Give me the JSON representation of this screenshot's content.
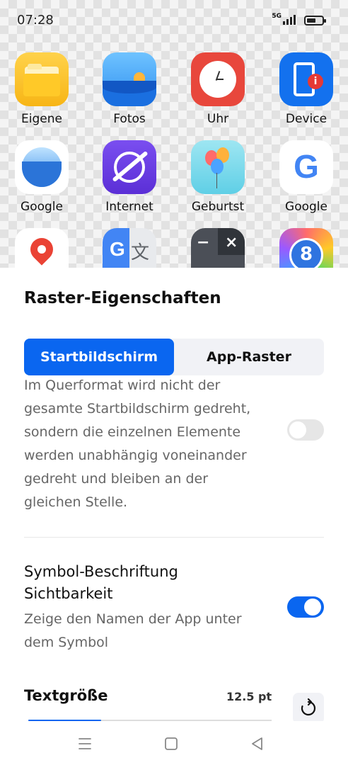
{
  "status_bar": {
    "time": "07:28",
    "network": "5G",
    "battery_level": 0.6
  },
  "apps": [
    {
      "label": "Eigene",
      "icon": "folder-icon"
    },
    {
      "label": "Fotos",
      "icon": "photos-icon"
    },
    {
      "label": "Uhr",
      "icon": "clock-icon"
    },
    {
      "label": "Device",
      "icon": "device-info-icon"
    },
    {
      "label": "Google",
      "icon": "google-earth-icon"
    },
    {
      "label": "Internet",
      "icon": "browser-icon"
    },
    {
      "label": "Geburtst",
      "icon": "balloons-icon"
    },
    {
      "label": "Google",
      "icon": "google-g-icon"
    },
    {
      "label": "",
      "icon": "maps-icon"
    },
    {
      "label": "",
      "icon": "translate-icon"
    },
    {
      "label": "",
      "icon": "calculator-icon"
    },
    {
      "label": "",
      "icon": "hourglass-icon"
    }
  ],
  "sheet": {
    "title": "Raster-Eigenschaften",
    "tabs": [
      {
        "label": "Startbildschirm",
        "active": true
      },
      {
        "label": "App-Raster",
        "active": false
      }
    ],
    "rotation_setting": {
      "description": "Im Querformat wird nicht der gesamte Startbildschirm gedreht, sondern die einzelnen Elemente werden unabhängig voneinander gedreht und bleiben an der gleichen Stelle.",
      "enabled": false
    },
    "label_visibility": {
      "title": "Symbol-Beschriftung Sichtbarkeit",
      "description": "Zeige den Namen der App unter dem Symbol",
      "enabled": true
    },
    "text_size": {
      "title": "Textgröße",
      "value": "12.5 pt",
      "slider_fraction": 0.3
    }
  },
  "colors": {
    "accent": "#0a66f0",
    "toggle_off": "#e6e6e6",
    "segment_bg": "#f1f2f6"
  }
}
